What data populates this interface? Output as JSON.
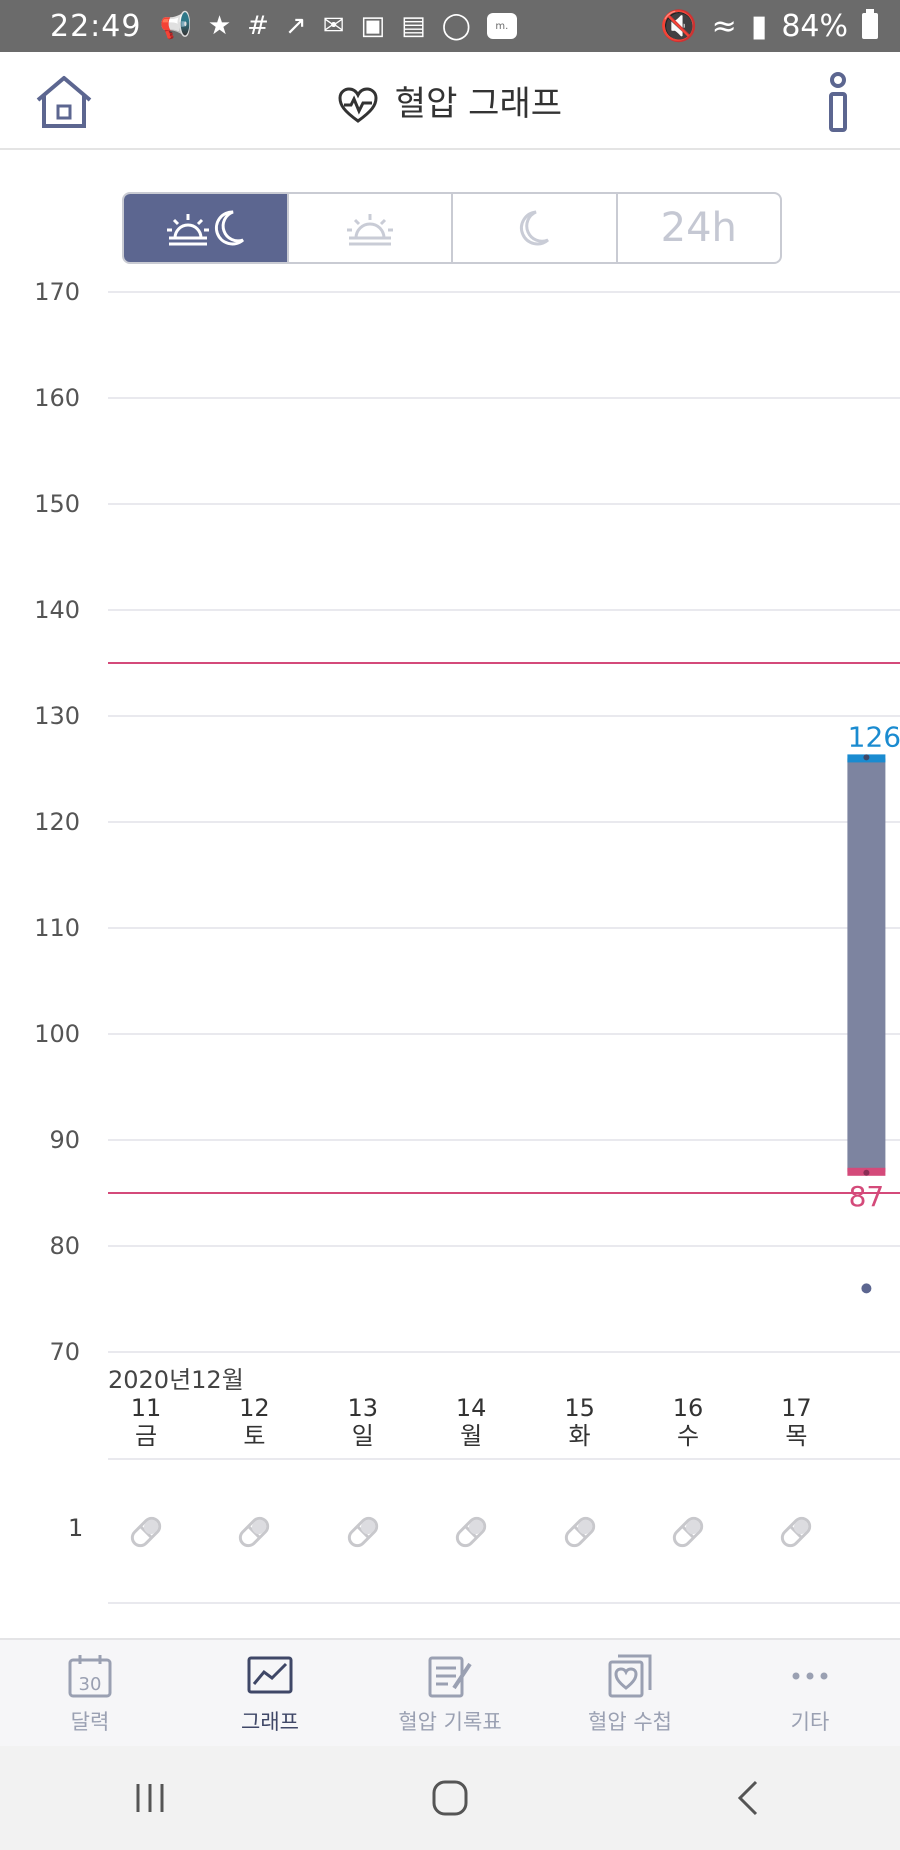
{
  "status_bar": {
    "time": "22:49",
    "battery": "84%",
    "notification_icons": [
      "megaphone-icon",
      "star-icon",
      "slack-icon",
      "chart-icon",
      "mail-icon",
      "instagram-icon",
      "gallery-icon",
      "chat-icon",
      "m-global-icon"
    ],
    "m_global_text": "m."
  },
  "appbar": {
    "title": "혈압 그래프"
  },
  "segments": {
    "options": [
      "morning-evening",
      "morning",
      "evening",
      "24h"
    ],
    "label_24h": "24h",
    "selected": 0
  },
  "chart_data": {
    "type": "bar",
    "ylim": [
      70,
      170
    ],
    "y_ticks": [
      "170",
      "160",
      "150",
      "140",
      "130",
      "120",
      "110",
      "100",
      "90",
      "80",
      "70"
    ],
    "reference_lines": [
      135,
      85
    ],
    "month_label": "2020년12월",
    "categories": [
      {
        "day": "11",
        "weekday": "금"
      },
      {
        "day": "12",
        "weekday": "토"
      },
      {
        "day": "13",
        "weekday": "일"
      },
      {
        "day": "14",
        "weekday": "월"
      },
      {
        "day": "15",
        "weekday": "화"
      },
      {
        "day": "16",
        "weekday": "수"
      },
      {
        "day": "17",
        "weekday": "목"
      }
    ],
    "bars": [
      {
        "day": "17",
        "systolic": 126,
        "diastolic": 87,
        "pulse": 76,
        "systolic_label": "126",
        "diastolic_label": "87"
      }
    ],
    "colors": {
      "bar": "#7d84a0",
      "systolic": "#1a8bd0",
      "diastolic": "#d44a7a",
      "pulse": "#5c6690",
      "limit": "#d44a7a"
    }
  },
  "medication_row": {
    "label": "1",
    "icon": "pill-icon"
  },
  "bottom_nav": {
    "items": [
      {
        "label": "달력",
        "icon": "calendar-icon",
        "icon_text": "30"
      },
      {
        "label": "그래프",
        "icon": "graph-icon"
      },
      {
        "label": "혈압 기록표",
        "icon": "record-sheet-icon"
      },
      {
        "label": "혈압 수첩",
        "icon": "notebook-icon"
      },
      {
        "label": "기타",
        "icon": "more-icon"
      }
    ],
    "active": 1
  },
  "colors": {
    "accent": "#5c6690",
    "status_bar": "#6b6b6b"
  }
}
